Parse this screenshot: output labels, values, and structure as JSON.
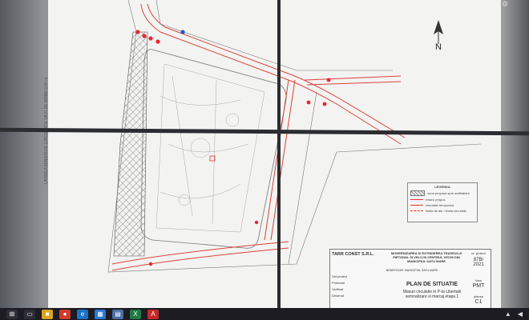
{
  "sheet": {
    "side_note": "LATIMEA MINIMA DE CIRCULATIE VA FI DE MINIM 3.00 m",
    "north_label": "N",
    "legend": {
      "title": "LEGENDA",
      "entries": [
        "zona propusa spre amfilabare",
        "traseu propus",
        "circulatie temporara",
        "limita de ale / limita circulatie"
      ]
    },
    "title_block": {
      "company": "TARR CONST S.R.L.",
      "project": "MODERNIZAREA SI EXTINDEREA TRASEULUI PIETONAL SI VELO IN CENTRUL VECHI DIN MUNICIPIUL SATU MARE",
      "beneficiary": "BENEFICIAR: MUNICIPIUL SATU MARE",
      "nr_label": "nr. proiect",
      "nr_value": "87B/ 2021",
      "roles": [
        "Sef proiect",
        "Proiectat",
        "Verificat",
        "Desenat"
      ],
      "plan_title": "PLAN DE SITUATIE",
      "plan_desc": "Masuri circulatie in P-ta Libertatii semnalizare si marcaj etapa 1",
      "faza_label": "faza",
      "faza_value": "PMT",
      "plansa_label": "plansa",
      "plansa_value": "C1"
    }
  },
  "taskbar": {
    "items": [
      {
        "name": "start-icon",
        "glyph": "⊞",
        "color": "#2d2d35"
      },
      {
        "name": "task-view-icon",
        "glyph": "▭",
        "color": "#2d2d35"
      },
      {
        "name": "file-explorer-icon",
        "glyph": "■",
        "color": "#d9a420"
      },
      {
        "name": "chrome-icon",
        "glyph": "●",
        "color": "#cf3b2c"
      },
      {
        "name": "edge-icon",
        "glyph": "e",
        "color": "#1a73c7"
      },
      {
        "name": "store-icon",
        "glyph": "▦",
        "color": "#2a78d3"
      },
      {
        "name": "app-icon",
        "glyph": "▤",
        "color": "#4b6ea8"
      },
      {
        "name": "excel-icon",
        "glyph": "X",
        "color": "#1f7a44"
      },
      {
        "name": "pdf-icon",
        "glyph": "A",
        "color": "#c62828"
      }
    ],
    "tray": [
      "network-icon",
      "volume-icon"
    ]
  }
}
